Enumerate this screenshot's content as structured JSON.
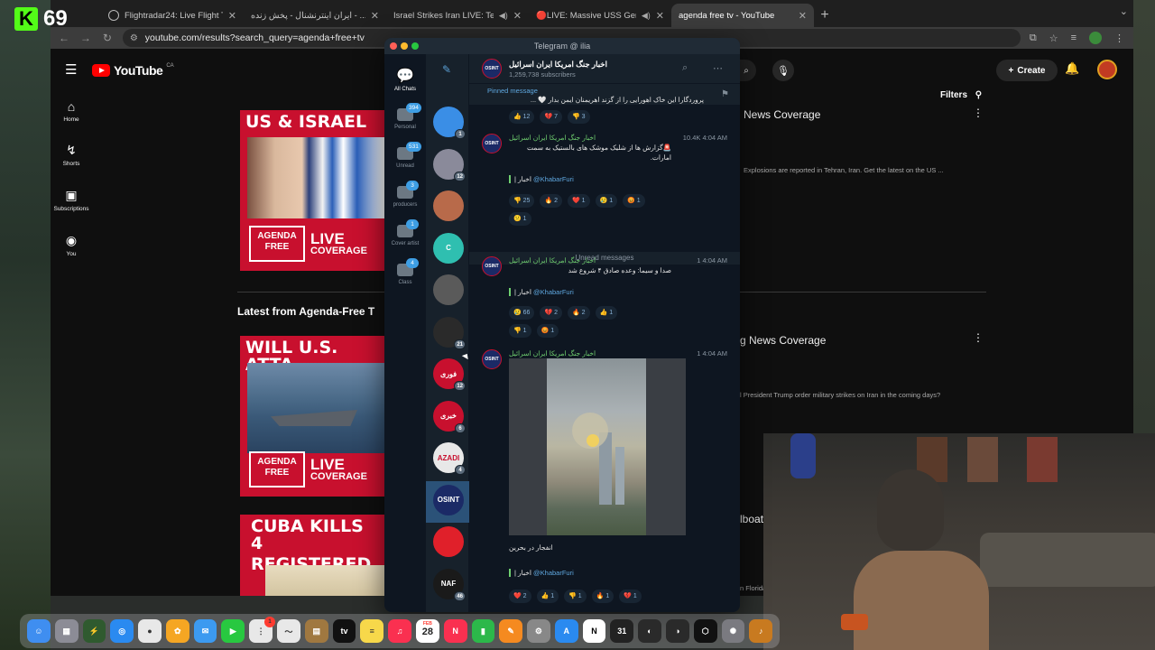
{
  "stream": {
    "viewer_count": "69",
    "badge_letter": "K"
  },
  "browser": {
    "tabs": [
      {
        "title": "Flightradar24: Live Flight Track...",
        "icon": "globe-icon"
      },
      {
        "title": "ایران اینترنشنال - پخش زنده - ...be",
        "icon": "youtube-icon"
      },
      {
        "title": "Israel Strikes Iran LIVE: Te",
        "icon": "youtube-icon"
      },
      {
        "title": "🔴LIVE: Massive USS Ger",
        "icon": "youtube-icon"
      },
      {
        "title": "agenda free tv - YouTube",
        "icon": "youtube-icon",
        "active": true
      }
    ],
    "url": "youtube.com/results?search_query=agenda+free+tv"
  },
  "youtube": {
    "logo_text": "YouTube",
    "country_code": "CA",
    "sidebar": [
      {
        "label": "Home",
        "icon": "home-icon"
      },
      {
        "label": "Shorts",
        "icon": "shorts-icon"
      },
      {
        "label": "Subscriptions",
        "icon": "subscriptions-icon"
      },
      {
        "label": "You",
        "icon": "account-icon"
      }
    ],
    "create_label": "Create",
    "filters_label": "Filters",
    "thumb1": {
      "headline": "US & ISRAEL",
      "badge": "AGENDA FREE",
      "live": "LIVE",
      "live_sub": "COVERAGE"
    },
    "section_title": "Latest from Agenda-Free T",
    "thumb2": {
      "headline": "WILL U.S. ATTA",
      "badge": "AGENDA FREE",
      "live": "LIVE",
      "live_sub": "COVERAGE"
    },
    "thumb3": {
      "headline": "CUBA KILLS 4",
      "subheadline": "REGISTERED"
    },
    "results": [
      {
        "title": "News Coverage",
        "desc": "Explosions are reported in Tehran, Iran. Get the latest on the US ..."
      },
      {
        "title": "g News Coverage",
        "desc": "l President Trump order military strikes on Iran in the coming days?"
      },
      {
        "title": "lboat - Li",
        "desc": "n Florida (Un"
      }
    ]
  },
  "telegram": {
    "window_title": "Telegram @ ilia",
    "folders": [
      {
        "label": "All Chats",
        "active": true
      },
      {
        "label": "Personal",
        "badge": "394"
      },
      {
        "label": "Unread",
        "badge": "531"
      },
      {
        "label": "producers",
        "badge": "3"
      },
      {
        "label": "Cover artist",
        "badge": "1"
      },
      {
        "label": "Class",
        "badge": "4"
      }
    ],
    "chat_avatars": [
      {
        "color": "#3a8ee6",
        "count": "1"
      },
      {
        "color": "#8a8a9a",
        "count": "12"
      },
      {
        "color": "#b86a4a",
        "count": ""
      },
      {
        "color": "#2fbfb0",
        "count": "",
        "letter": "C"
      },
      {
        "color": "#5a5a5a",
        "count": ""
      },
      {
        "color": "#2a2a2a",
        "count": "21"
      },
      {
        "color": "#c8102e",
        "count": "12",
        "letter": "فوری"
      },
      {
        "color": "#c8102e",
        "count": "6",
        "letter": "خبری"
      },
      {
        "color": "#e8e8e8",
        "count": "4",
        "letter": "AZADI"
      },
      {
        "color": "#1b2a66",
        "count": "",
        "letter": "OSINT"
      },
      {
        "color": "#e0202a",
        "count": ""
      },
      {
        "color": "#1a1a1a",
        "count": "46",
        "letter": "NAF"
      }
    ],
    "channel": {
      "name": "اخبار جنگ امریکا ایران اسرائیل",
      "subscribers": "1,259,738 subscribers"
    },
    "pinned": {
      "label": "Pinned message",
      "text": "پروردگارا این خاک اهورایی را از گزند اهریمنان ایمن بدار 🤍 ..."
    },
    "unread_label": "Unread messages",
    "signature_prefix": "| اخبار",
    "signature_link": "@KhabarFuri",
    "messages": [
      {
        "sender": "اخبار جنگ امریکا ایران اسرائیل",
        "meta": "10.4K 4:04 AM",
        "text": "🚨گزارش ها از شلیک موشک های بالستیک به سمت امارات."
      },
      {
        "sender": "اخبار جنگ امریکا ایران اسرائیل",
        "meta": "1 4:04 AM",
        "text": "صدا و سیما: وعده صادق ۴ شروع شد"
      },
      {
        "sender": "اخبار جنگ امریکا ایران اسرائیل",
        "meta": "1 4:04 AM",
        "text": "انفجار در بحرین"
      }
    ],
    "pinned_reactions": [
      "👍 12",
      "💔 7",
      "👎 3"
    ],
    "reactions1": [
      "👎 25",
      "🔥 2",
      "❤️ 1",
      "😢 1",
      "😡 1"
    ],
    "reactions1b": [
      "😕 1"
    ],
    "reactions2": [
      "😢 66",
      "💔 2",
      "🔥 2",
      "👍 1"
    ],
    "reactions2b": [
      "👎 1",
      "😡 1"
    ],
    "reactions3": [
      "❤️ 2",
      "👍 1",
      "👎 1",
      "🔥 1",
      "💔 1"
    ]
  },
  "dock": {
    "calendar_month": "FEB",
    "calendar_day": "28",
    "badge_count": "1"
  }
}
